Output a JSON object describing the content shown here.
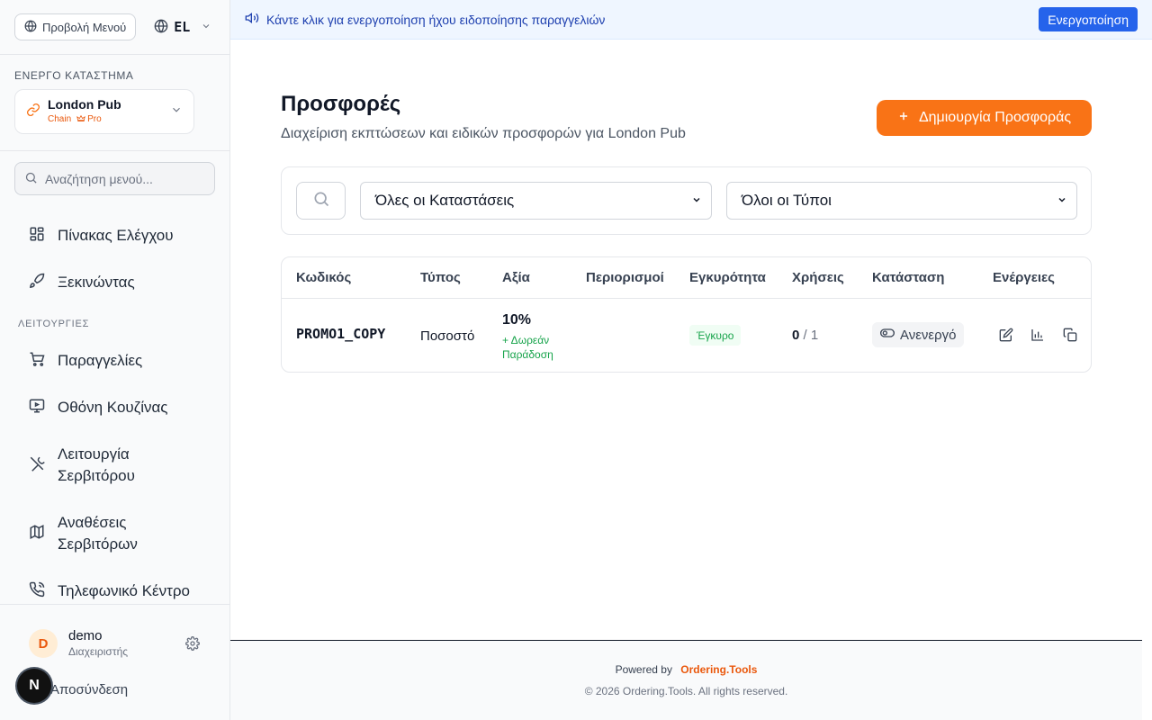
{
  "sidebar": {
    "menu_view_label": "Προβολή Μενού",
    "language_code": "EL",
    "active_store_label": "ΕΝΕΡΓΟ ΚΑΤΑΣΤΗΜΑ",
    "store_name": "London Pub",
    "store_type": "Chain",
    "store_plan": "Pro",
    "search_placeholder": "Αναζήτηση μενού...",
    "items_top": [
      {
        "label": "Πίνακας Ελέγχου",
        "icon": "dashboard-icon"
      },
      {
        "label": "Ξεκινώντας",
        "icon": "rocket-icon"
      }
    ],
    "section_label": "ΛΕΙΤΟΥΡΓΙΕΣ",
    "items": [
      {
        "label": "Παραγγελίες",
        "icon": "cart-icon"
      },
      {
        "label": "Οθόνη Κουζίνας",
        "icon": "monitor-icon"
      },
      {
        "label": "Λειτουργία Σερβιτόρου",
        "icon": "utensils-icon"
      },
      {
        "label": "Αναθέσεις Σερβιτόρων",
        "icon": "map-icon"
      },
      {
        "label": "Τηλεφωνικό Κέντρο",
        "icon": "phone-icon"
      }
    ],
    "user": {
      "initial": "D",
      "name": "demo",
      "role": "Διαχειριστής"
    },
    "logout_label": "Αποσύνδεση",
    "dev_badge": "N"
  },
  "banner": {
    "text": "Κάντε κλικ για ενεργοποίηση ήχου ειδοποίησης παραγγελιών",
    "button_label": "Ενεργοποίηση"
  },
  "main": {
    "title": "Προσφορές",
    "subtitle": "Διαχείριση εκπτώσεων και ειδικών προσφορών για London Pub",
    "create_button_label": "Δημιουργία Προσφοράς",
    "filters": {
      "status_selected": "Όλες οι Καταστάσεις",
      "type_selected": "Όλοι οι Τύποι"
    },
    "table": {
      "headers": [
        "Κωδικός",
        "Τύπος",
        "Αξία",
        "Περιορισμοί",
        "Εγκυρότητα",
        "Χρήσεις",
        "Κατάσταση",
        "Ενέργειες"
      ],
      "rows": [
        {
          "code": "PROMO1_COPY",
          "type": "Ποσοστό",
          "value": "10%",
          "value_extra": "+ Δωρεάν Παράδοση",
          "restrictions": "",
          "validity": "Έγκυρο",
          "uses_used": "0",
          "uses_total": "/ 1",
          "status": "Ανενεργό"
        }
      ]
    }
  },
  "footer": {
    "powered_by": "Powered by",
    "brand": "Ordering.Tools",
    "copyright": "© 2026 Ordering.Tools. All rights reserved."
  },
  "colors": {
    "accent": "#f97316",
    "banner_button": "#2563eb",
    "valid_green": "#16a34a"
  }
}
